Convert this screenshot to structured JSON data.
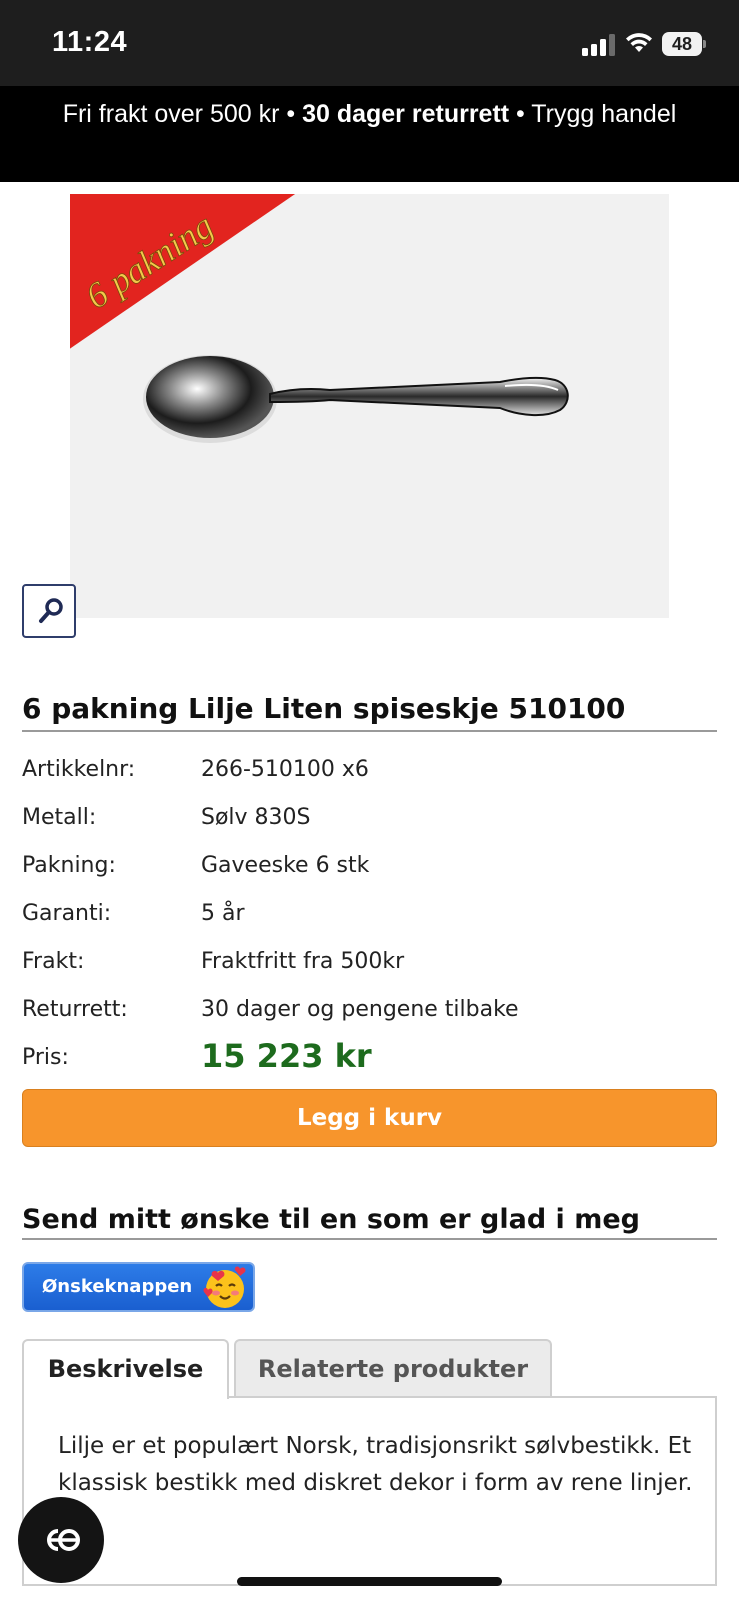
{
  "status": {
    "time": "11:24",
    "battery": "48",
    "icons": [
      "signal-icon",
      "wifi-icon",
      "battery-icon"
    ]
  },
  "promo": {
    "part1": "Fri frakt over 500 kr • ",
    "part2": "30 dager returrett",
    "part3": " • Trygg handel"
  },
  "image": {
    "ribbon_text": "6 pakning",
    "alt": "spoon"
  },
  "product": {
    "title": "6 pakning Lilje Liten spiseskje 510100",
    "specs": [
      {
        "label": "Artikkelnr:",
        "value": "266-510100 x6"
      },
      {
        "label": "Metall:",
        "value": "Sølv 830S"
      },
      {
        "label": "Pakning:",
        "value": "Gaveeske 6 stk"
      },
      {
        "label": "Garanti:",
        "value": "5 år"
      },
      {
        "label": "Frakt:",
        "value": "Fraktfritt fra 500kr"
      },
      {
        "label": "Returrett:",
        "value": "30 dager og pengene tilbake"
      }
    ],
    "price_label": "Pris:",
    "price": "15 223 kr",
    "price_color": "#1d6b1d"
  },
  "cart": {
    "button_label": "Legg i kurv",
    "color": "#f7952c"
  },
  "wish": {
    "title": "Send mitt ønske til en som er glad i meg",
    "button_label": "Ønskeknappen"
  },
  "tabs": [
    {
      "label": "Beskrivelse",
      "active": true
    },
    {
      "label": "Relaterte produkter",
      "active": false
    }
  ],
  "description": "Lilje er et populært Norsk, tradisjonsrikt sølvbestikk. Et klassisk bestikk med diskret dekor i form av rene linjer."
}
